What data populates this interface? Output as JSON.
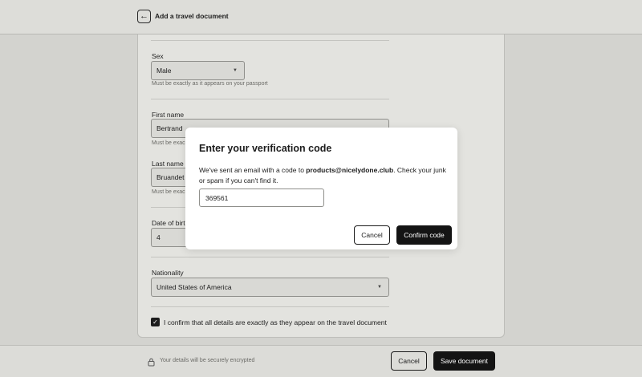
{
  "header": {
    "title": "Add a travel document"
  },
  "form": {
    "sex": {
      "label": "Sex",
      "value": "Male",
      "hint": "Must be exactly as it appears on your passport"
    },
    "first_name": {
      "label": "First name",
      "value": "Bertrand",
      "hint_partial": "Must be exac"
    },
    "last_name": {
      "label": "Last name",
      "value": "Bruandet",
      "hint_partial": "Must be exac"
    },
    "dob": {
      "label_partial": "Date of birt",
      "day_value": "4"
    },
    "nationality": {
      "label": "Nationality",
      "value": "United States of America"
    },
    "confirm": {
      "checked": true,
      "label": "I confirm that all details are exactly as they appear on the travel document"
    }
  },
  "footer": {
    "secure_text": "Your details will be securely encrypted",
    "cancel_label": "Cancel",
    "save_label": "Save document"
  },
  "modal": {
    "title": "Enter your verification code",
    "body_prefix": "We've sent an email with a code to ",
    "email": "products@nicelydone.club",
    "body_suffix": ". Check your junk or spam if you can't find it.",
    "code_value": "369561",
    "cancel_label": "Cancel",
    "confirm_label": "Confirm code"
  },
  "icons": {
    "back": "arrow-left-icon",
    "lock": "lock-icon",
    "caret": "chevron-down-icon",
    "check": "checkmark-icon"
  },
  "colors": {
    "primary_button": "#141414",
    "page_background": "#d3d3cf",
    "modal_background": "#ffffff"
  }
}
